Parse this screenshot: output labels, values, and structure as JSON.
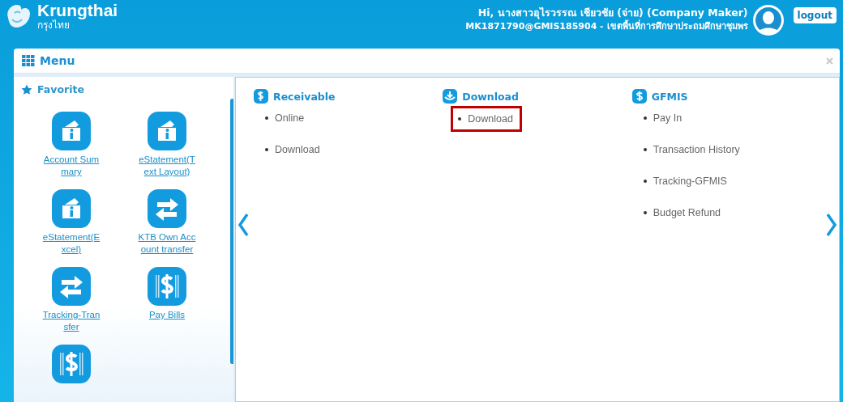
{
  "header": {
    "brand": "Krungthai",
    "brand_thai": "กรุงไทย",
    "greeting": "Hi, นางสาวอุไรวรรณ เชียวชัย (จ่าย) (Company Maker)",
    "account": "MK1871790@GMIS185904 - เขตพื้นที่การศึกษาประถมศึกษาชุมพร",
    "logout": "logout"
  },
  "menu": {
    "title": "Menu",
    "favorite": {
      "title": "Favorite",
      "items": [
        {
          "kind": "info",
          "label": "Account Summary"
        },
        {
          "kind": "info",
          "label": "eStatement(Text Layout)"
        },
        {
          "kind": "info",
          "label": "eStatement(Excel)"
        },
        {
          "kind": "transfer",
          "label": "KTB Own Account transfer"
        },
        {
          "kind": "transfer",
          "label": "Tracking-Transfer"
        },
        {
          "kind": "bill",
          "label": "Pay Bills"
        },
        {
          "kind": "bill"
        }
      ]
    },
    "sections": [
      {
        "kind": "receivable",
        "title": "Receivable",
        "items": [
          {
            "label": "Online",
            "highlighted": false
          },
          {
            "label": "Download",
            "highlighted": false
          }
        ]
      },
      {
        "kind": "download",
        "title": "Download",
        "items": [
          {
            "label": "Download",
            "highlighted": true
          }
        ]
      },
      {
        "kind": "gfmis",
        "title": "GFMIS",
        "items": [
          {
            "label": "Pay In",
            "highlighted": false
          },
          {
            "label": "Transaction History",
            "highlighted": false
          },
          {
            "label": "Tracking-GFMIS",
            "highlighted": false
          },
          {
            "label": "Budget Refund",
            "highlighted": false
          }
        ]
      }
    ]
  }
}
